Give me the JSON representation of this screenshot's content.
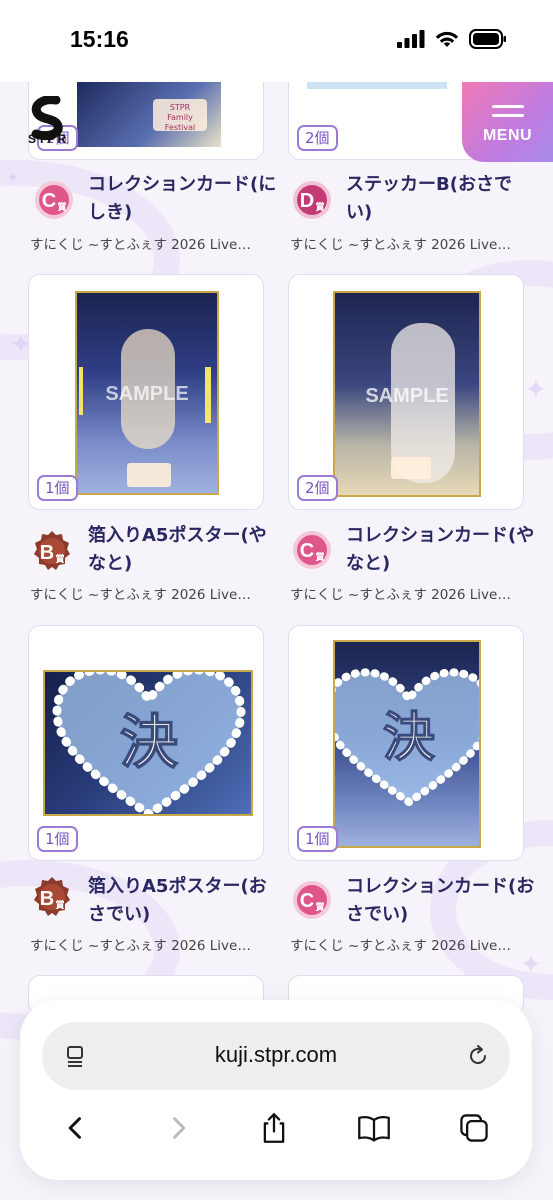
{
  "status_bar": {
    "time": "15:16"
  },
  "header": {
    "logo_text": "STPR",
    "menu_label": "MENU"
  },
  "items": [
    {
      "qty": "1個",
      "prize": "C",
      "prize_suffix": "賞",
      "title": "コレクションカード(にしき)",
      "subtitle": "すにくじ ~すとふぇす 2026 Live…"
    },
    {
      "qty": "2個",
      "prize": "D",
      "prize_suffix": "賞",
      "title": "ステッカーB(おさでい)",
      "subtitle": "すにくじ ~すとふぇす 2026 Live…"
    },
    {
      "qty": "1個",
      "prize": "B",
      "prize_suffix": "賞",
      "title": "箔入りA5ポスター(やなと)",
      "subtitle": "すにくじ ~すとふぇす 2026 Live…",
      "watermark": "SAMPLE"
    },
    {
      "qty": "2個",
      "prize": "C",
      "prize_suffix": "賞",
      "title": "コレクションカード(やなと)",
      "subtitle": "すにくじ ~すとふぇす 2026 Live…",
      "watermark": "SAMPLE"
    },
    {
      "qty": "1個",
      "prize": "B",
      "prize_suffix": "賞",
      "title": "箔入りA5ポスター(おさでい)",
      "subtitle": "すにくじ ~すとふぇす 2026 Live…",
      "overlay_char": "決"
    },
    {
      "qty": "1個",
      "prize": "C",
      "prize_suffix": "賞",
      "title": "コレクションカード(おさでい)",
      "subtitle": "すにくじ ~すとふぇす 2026 Live…",
      "overlay_char": "決"
    }
  ],
  "browser": {
    "url": "kuji.stpr.com"
  },
  "colors": {
    "accent_pink": "#f07ab6",
    "accent_purple": "#a88be8",
    "prize_B": "#8c3b2a",
    "prize_C": "#e0558a",
    "prize_D": "#c23b75",
    "badge_border": "#9c7ad8"
  }
}
